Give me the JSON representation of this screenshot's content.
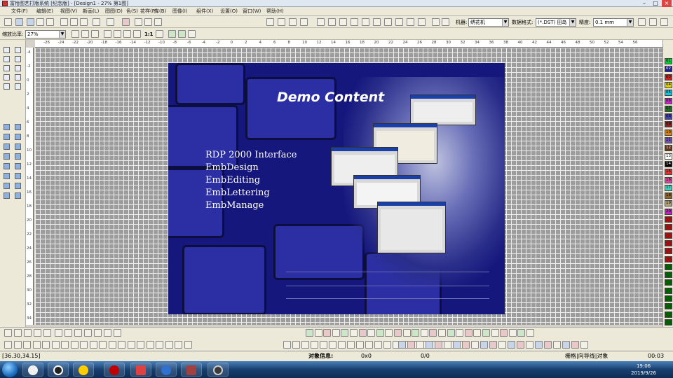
{
  "window": {
    "title": "富怡图艺打版系统 [纪念版] - [Design1 - 27% 第1图]",
    "min": "–",
    "max": "□",
    "close": "×"
  },
  "menu": [
    {
      "label": "文件(F)"
    },
    {
      "label": "编辑(E)"
    },
    {
      "label": "视图(V)"
    },
    {
      "label": "新画(L)"
    },
    {
      "label": "图图(D)"
    },
    {
      "label": "色(S)"
    },
    {
      "label": "花样(P)"
    },
    {
      "label": "库(B)"
    },
    {
      "label": "图像(I)"
    },
    {
      "label": "组件(X)"
    },
    {
      "label": "设置(O)"
    },
    {
      "label": "窗口(W)"
    },
    {
      "label": "帮助(H)"
    }
  ],
  "toolbar": {
    "machine_label": "机器:",
    "machine_value": "绣花机",
    "format_label": "数据格式:",
    "format_value": "(*.DST) 田岛",
    "precision_label": "精度:",
    "precision_value": "0.1 mm",
    "zoom_label": "缩放比率:",
    "zoom_value": "27%",
    "one_to_one": "1:1"
  },
  "ruler": {
    "h_ticks": [
      "-26",
      "-24",
      "-22",
      "-20",
      "-18",
      "-16",
      "-14",
      "-12",
      "-10",
      "-8",
      "-6",
      "-4",
      "-2",
      "0",
      "2",
      "4",
      "6",
      "8",
      "10",
      "12",
      "14",
      "16",
      "18",
      "20",
      "22",
      "24",
      "26",
      "28",
      "30",
      "32",
      "34",
      "36",
      "38",
      "40",
      "42",
      "44",
      "46",
      "48",
      "50",
      "52",
      "54",
      "56"
    ],
    "v_ticks": [
      "-4",
      "-2",
      "0",
      "2",
      "4",
      "6",
      "8",
      "10",
      "12",
      "14",
      "16",
      "18",
      "20",
      "22",
      "24",
      "26",
      "28",
      "30",
      "32",
      "34"
    ]
  },
  "demo": {
    "title": "Demo Content",
    "items": [
      "RDP 2000 Interface",
      "EmbDesign",
      "EmbEditing",
      "EmbLettering",
      "EmbManage"
    ]
  },
  "palette": [
    {
      "label": "01",
      "color": "#00cc33"
    },
    {
      "label": "02",
      "color": "#1a1aa0"
    },
    {
      "label": "03",
      "color": "#d02020"
    },
    {
      "label": "04",
      "color": "#e0d000"
    },
    {
      "label": "05",
      "color": "#00c8e8"
    },
    {
      "label": "06",
      "color": "#d020d0"
    },
    {
      "label": "07",
      "color": "#207020"
    },
    {
      "label": "08",
      "color": "#4040c0"
    },
    {
      "label": "09",
      "color": "#902020"
    },
    {
      "label": "10",
      "color": "#e08000"
    },
    {
      "label": "11",
      "color": "#7050b0"
    },
    {
      "label": "12",
      "color": "#603010"
    },
    {
      "label": "13",
      "color": "#ffffff"
    },
    {
      "label": "14",
      "color": "#000000"
    },
    {
      "label": "15",
      "color": "#e03030"
    },
    {
      "label": "16",
      "color": "#e040a0"
    },
    {
      "label": "17",
      "color": "#40d0c0"
    },
    {
      "label": "18",
      "color": "#906020"
    },
    {
      "label": "19",
      "color": "#b0a070"
    },
    {
      "label": "20",
      "color": "#c020c0"
    },
    {
      "label": "",
      "color": "#a01010"
    },
    {
      "label": "",
      "color": "#a01010"
    },
    {
      "label": "",
      "color": "#a01010"
    },
    {
      "label": "",
      "color": "#a01010"
    },
    {
      "label": "",
      "color": "#a01010"
    },
    {
      "label": "",
      "color": "#a01010"
    },
    {
      "label": "",
      "color": "#006000"
    },
    {
      "label": "",
      "color": "#006000"
    },
    {
      "label": "",
      "color": "#006000"
    },
    {
      "label": "",
      "color": "#006000"
    },
    {
      "label": "",
      "color": "#006000"
    },
    {
      "label": "",
      "color": "#006000"
    },
    {
      "label": "",
      "color": "#006000"
    },
    {
      "label": "",
      "color": "#006000"
    },
    {
      "label": "",
      "color": "#006000"
    }
  ],
  "status": {
    "coords": "[36.30,34.15]",
    "object_label": "对象信息:",
    "object_value": "0x0",
    "count": "0/0",
    "modes": "栅格|向导线|对象",
    "time": "00:03"
  },
  "taskbar": {
    "time": "19:06",
    "date": "2019/9/26"
  }
}
